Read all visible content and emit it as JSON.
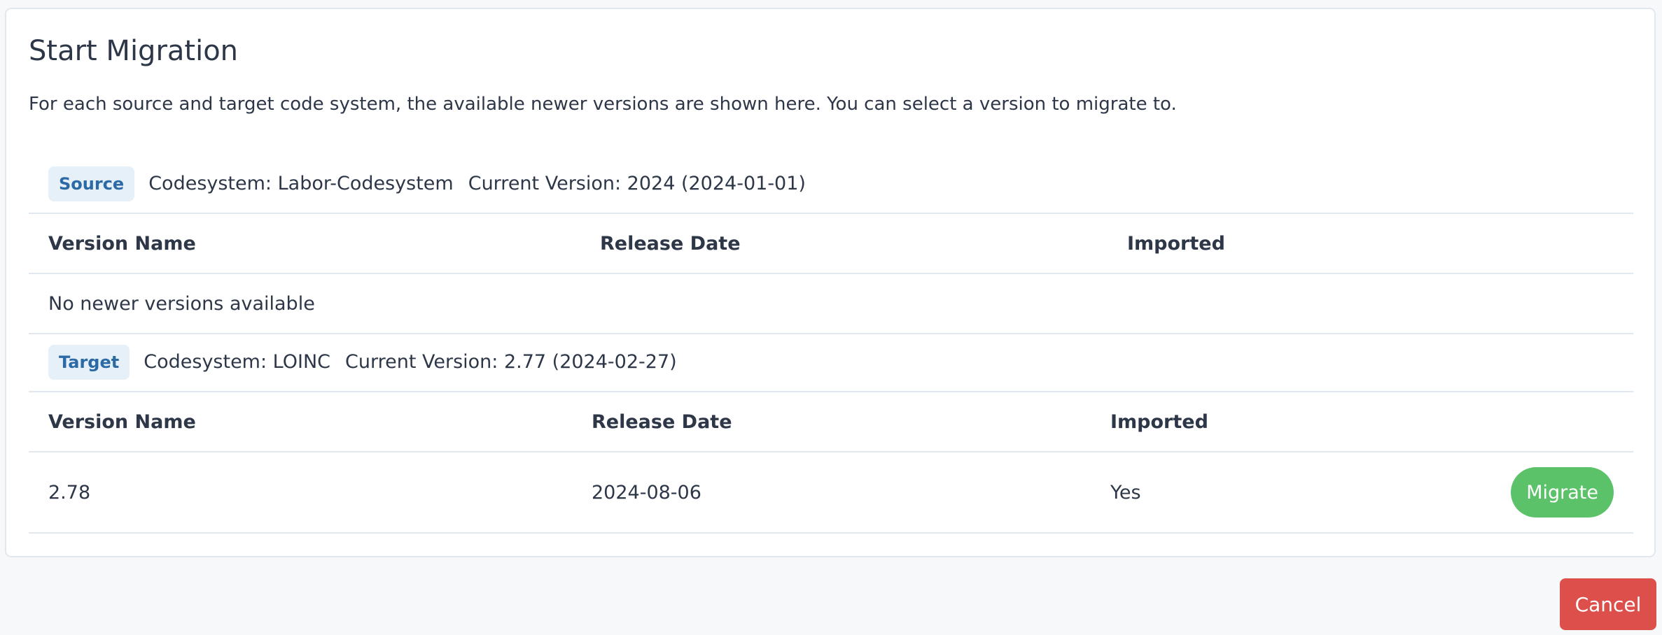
{
  "card": {
    "title": "Start Migration",
    "description": "For each source and target code system, the available newer versions are shown here. You can select a version to migrate to."
  },
  "source": {
    "badge": "Source",
    "codesystem": "Codesystem: Labor-Codesystem",
    "current_version": "Current Version: 2024 (2024-01-01)",
    "columns": [
      "Version Name",
      "Release Date",
      "Imported"
    ],
    "empty_message": "No newer versions available"
  },
  "target": {
    "badge": "Target",
    "codesystem": "Codesystem: LOINC",
    "current_version": "Current Version: 2.77 (2024-02-27)",
    "columns": [
      "Version Name",
      "Release Date",
      "Imported"
    ],
    "rows": [
      {
        "version_name": "2.78",
        "release_date": "2024-08-06",
        "imported": "Yes",
        "action_label": "Migrate"
      }
    ]
  },
  "footer": {
    "cancel_label": "Cancel"
  },
  "colors": {
    "source_badge_bg": "#e6f0f9",
    "badge_text": "#2b6aa5",
    "migrate_button": "#5cc26a",
    "cancel_button": "#dc4f4a"
  }
}
